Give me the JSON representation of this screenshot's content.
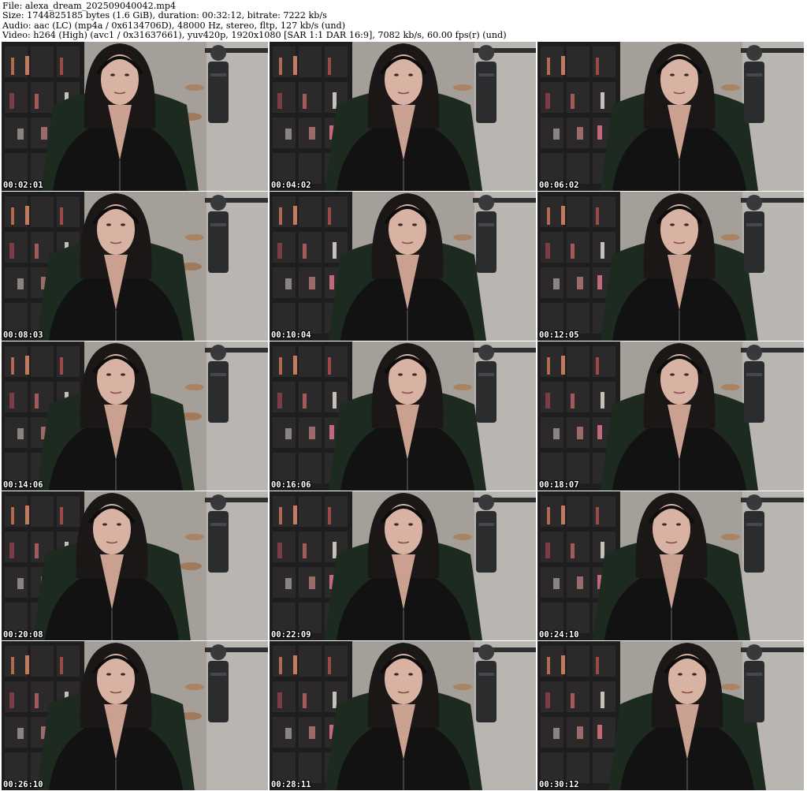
{
  "header": {
    "file": "File: alexa_dream_202509040042.mp4",
    "size": "Size: 1744825185 bytes (1.6 GiB), duration: 00:32:12, bitrate: 7222 kb/s",
    "audio": "Audio: aac (LC) (mp4a / 0x6134706D), 48000 Hz, stereo, fltp, 127 kb/s (und)",
    "video": "Video: h264 (High) (avc1 / 0x31637661), yuv420p, 1920x1080 [SAR 1:1 DAR 16:9], 7082 kb/s, 60.00 fps(r) (und)"
  },
  "thumbnails": [
    {
      "timestamp": "00:02:01"
    },
    {
      "timestamp": "00:04:02"
    },
    {
      "timestamp": "00:06:02"
    },
    {
      "timestamp": "00:08:03"
    },
    {
      "timestamp": "00:10:04"
    },
    {
      "timestamp": "00:12:05"
    },
    {
      "timestamp": "00:14:06"
    },
    {
      "timestamp": "00:16:06"
    },
    {
      "timestamp": "00:18:07"
    },
    {
      "timestamp": "00:20:08"
    },
    {
      "timestamp": "00:22:09"
    },
    {
      "timestamp": "00:24:10"
    },
    {
      "timestamp": "00:26:10"
    },
    {
      "timestamp": "00:28:11"
    },
    {
      "timestamp": "00:30:12"
    }
  ],
  "colors": {
    "background": "#ffffff",
    "wall": "#a49f99",
    "shelf": "#1f1e1f",
    "hoodie": "#121212",
    "skin": "#d8b2a2",
    "hair": "#1a1716",
    "mic": "#2b2c2e",
    "timestamp_text": "#ffffff"
  }
}
